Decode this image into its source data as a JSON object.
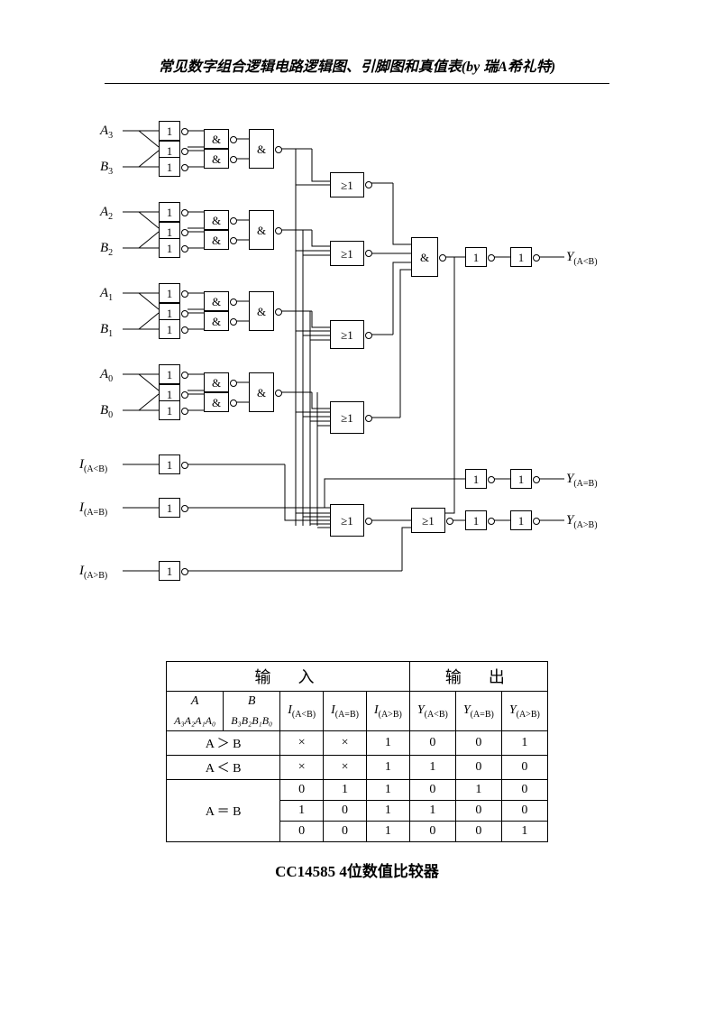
{
  "header": "常见数字组合逻辑电路逻辑图、引脚图和真值表(by 瑞A希礼特)",
  "caption": "CC14585 4位数值比较器",
  "inputs": {
    "A3": "A",
    "A3sub": "3",
    "B3": "B",
    "B3sub": "3",
    "A2": "A",
    "A2sub": "2",
    "B2": "B",
    "B2sub": "2",
    "A1": "A",
    "A1sub": "1",
    "B1": "B",
    "B1sub": "1",
    "A0": "A",
    "A0sub": "0",
    "B0": "B",
    "B0sub": "0",
    "IltB": "I",
    "IltBsub": "(A<B)",
    "IeqB": "I",
    "IeqBsub": "(A=B)",
    "IgtB": "I",
    "IgtBsub": "(A>B)"
  },
  "outputs": {
    "Ylt": "Y",
    "Yltsub": "(A<B)",
    "Yeq": "Y",
    "Yeqsub": "(A=B)",
    "Ygt": "Y",
    "Ygtsub": "(A>B)"
  },
  "gate_symbols": {
    "buf": "1",
    "and": "&",
    "or": "≥1"
  },
  "table": {
    "hdr_input": "输入",
    "hdr_output": "输出",
    "col_A": "A",
    "col_B": "B",
    "col_Adetail": "A₃A₂A₁A₀",
    "col_Bdetail": "B₃B₂B₁B₀",
    "col_Ilt": "I",
    "col_Ilt_sub": "(A<B)",
    "col_Ieq": "I",
    "col_Ieq_sub": "(A=B)",
    "col_Igt": "I",
    "col_Igt_sub": "(A>B)",
    "col_Ylt": "Y",
    "col_Ylt_sub": "(A<B)",
    "col_Yeq": "Y",
    "col_Yeq_sub": "(A=B)",
    "col_Ygt": "Y",
    "col_Ygt_sub": "(A>B)",
    "row_gt": "A ＞ B",
    "row_lt": "A ＜ B",
    "row_eq": "A ＝ B",
    "rows": [
      {
        "cond": "gt",
        "Ilt": "×",
        "Ieq": "×",
        "Igt": "1",
        "Ylt": "0",
        "Yeq": "0",
        "Ygt": "1"
      },
      {
        "cond": "lt",
        "Ilt": "×",
        "Ieq": "×",
        "Igt": "1",
        "Ylt": "1",
        "Yeq": "0",
        "Ygt": "0"
      },
      {
        "cond": "eq",
        "Ilt": "0",
        "Ieq": "1",
        "Igt": "1",
        "Ylt": "0",
        "Yeq": "1",
        "Ygt": "0"
      },
      {
        "cond": "eq",
        "Ilt": "1",
        "Ieq": "0",
        "Igt": "1",
        "Ylt": "1",
        "Yeq": "0",
        "Ygt": "0"
      },
      {
        "cond": "eq",
        "Ilt": "0",
        "Ieq": "0",
        "Igt": "1",
        "Ylt": "0",
        "Yeq": "0",
        "Ygt": "1"
      }
    ]
  },
  "chart_data": {
    "type": "table",
    "title": "CC14585 4位数值比较器 真值表",
    "columns": [
      "A vs B",
      "I(A<B)",
      "I(A=B)",
      "I(A>B)",
      "Y(A<B)",
      "Y(A=B)",
      "Y(A>B)"
    ],
    "rows": [
      [
        "A>B",
        "×",
        "×",
        "1",
        "0",
        "0",
        "1"
      ],
      [
        "A<B",
        "×",
        "×",
        "1",
        "1",
        "0",
        "0"
      ],
      [
        "A=B",
        "0",
        "1",
        "1",
        "0",
        "1",
        "0"
      ],
      [
        "A=B",
        "1",
        "0",
        "1",
        "1",
        "0",
        "0"
      ],
      [
        "A=B",
        "0",
        "0",
        "1",
        "0",
        "0",
        "1"
      ]
    ]
  }
}
